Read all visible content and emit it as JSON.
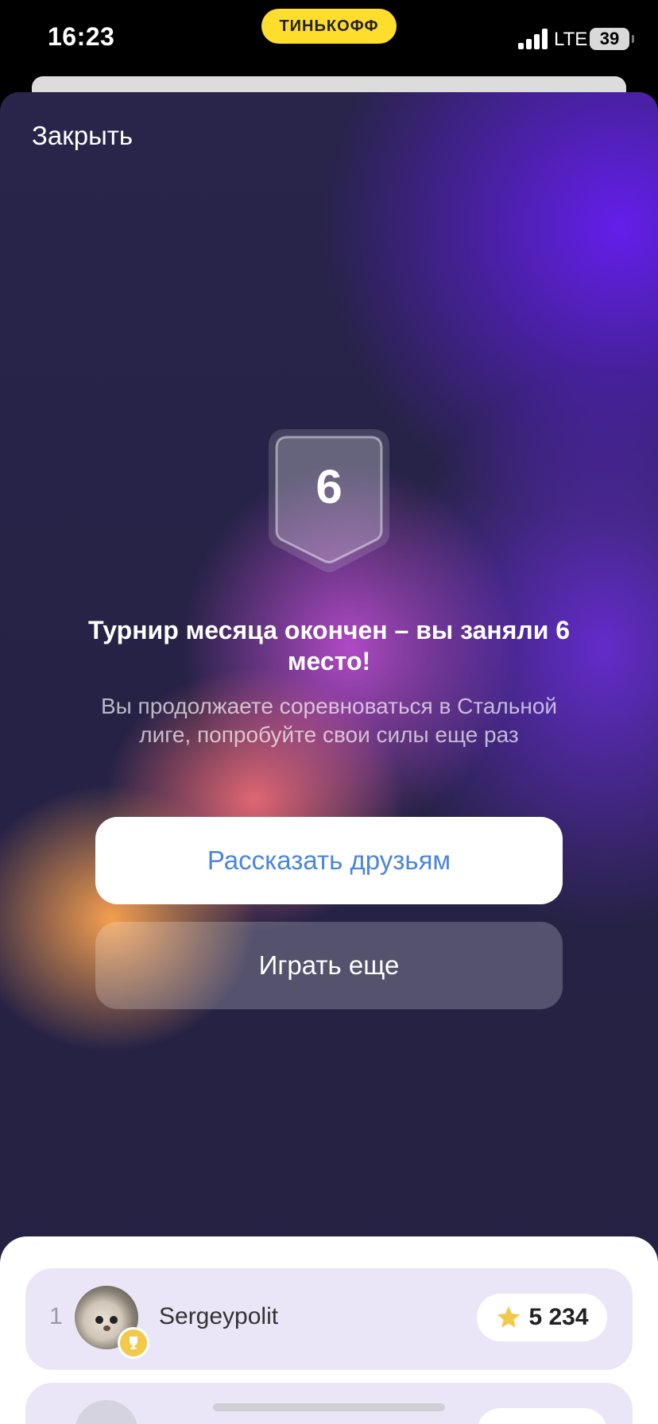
{
  "status_bar": {
    "time": "16:23",
    "brand": "ТИНЬКОФФ",
    "network": "LTE",
    "battery": "39"
  },
  "modal": {
    "close_label": "Закрыть",
    "place_number": "6",
    "headline": "Турнир месяца окончен – вы заняли 6 место!",
    "subtext": "Вы продолжаете соревноваться в Стальной лиге, попробуйте свои силы еще раз",
    "share_button": "Рассказать друзьям",
    "play_button": "Играть еще"
  },
  "leaderboard": {
    "rows": [
      {
        "rank": "1",
        "username": "Sergeypolit",
        "score": "5 234"
      }
    ]
  },
  "colors": {
    "brand_yellow": "#ffdd2d",
    "accent_purple": "#6a2fe8",
    "share_text": "#4a86d9",
    "row_bg": "#eae6f8",
    "star": "#f3c94a"
  }
}
